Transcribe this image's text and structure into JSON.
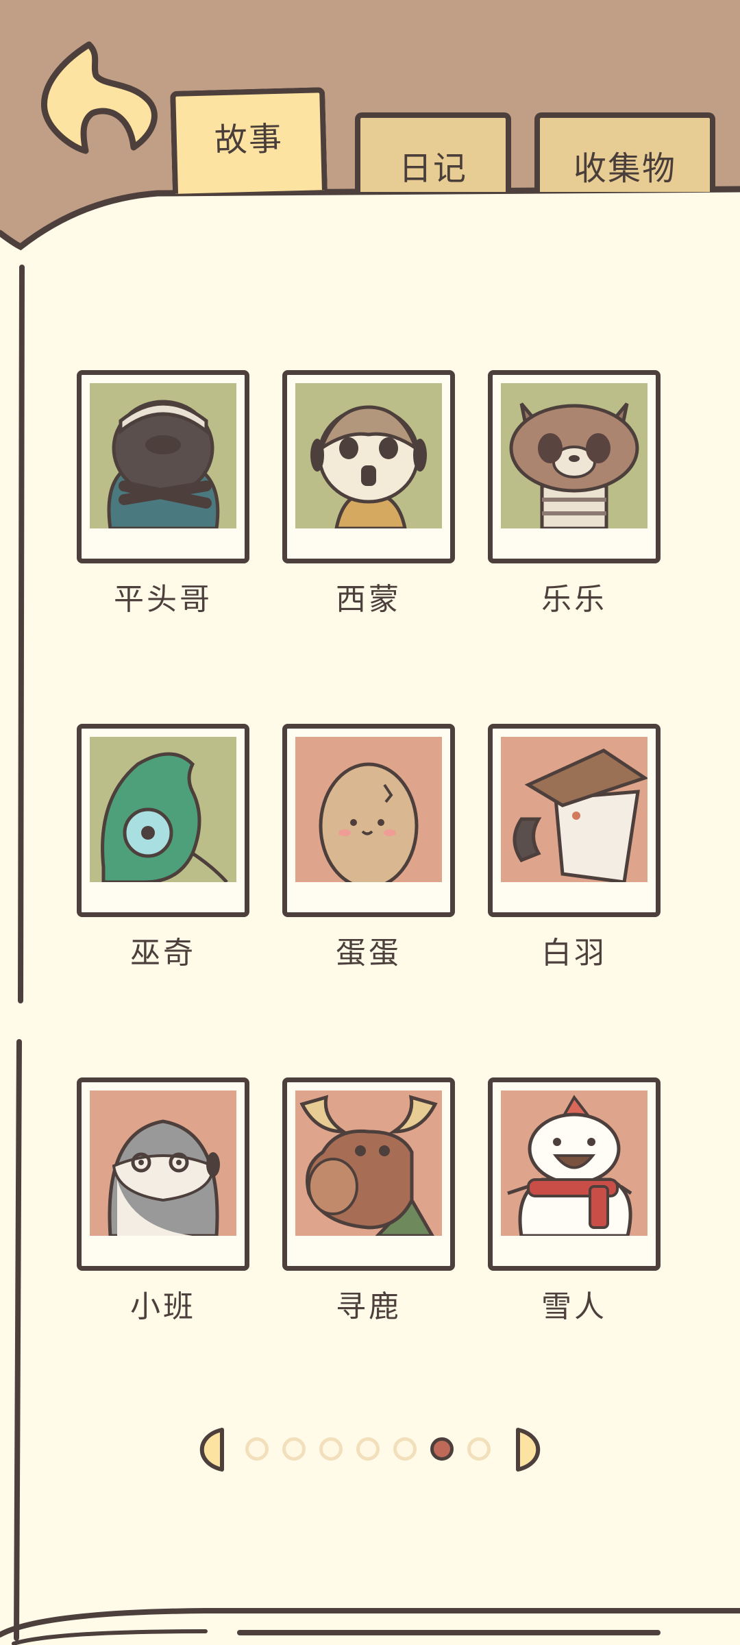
{
  "tabs": {
    "story": "故事",
    "diary": "日记",
    "collection": "收集物"
  },
  "characters": [
    {
      "name": "平头哥",
      "bg": "#bcbe8a",
      "icon": "honey-badger-portrait"
    },
    {
      "name": "西蒙",
      "bg": "#bcbe8a",
      "icon": "meerkat-portrait"
    },
    {
      "name": "乐乐",
      "bg": "#bcbe8a",
      "icon": "raccoon-dog-portrait"
    },
    {
      "name": "巫奇",
      "bg": "#bcbe8a",
      "icon": "chameleon-portrait"
    },
    {
      "name": "蛋蛋",
      "bg": "#dfa58c",
      "icon": "egg-portrait"
    },
    {
      "name": "白羽",
      "bg": "#dfa58c",
      "icon": "bird-portrait"
    },
    {
      "name": "小班",
      "bg": "#dfa58c",
      "icon": "otter-portrait"
    },
    {
      "name": "寻鹿",
      "bg": "#dfa58c",
      "icon": "moose-portrait"
    },
    {
      "name": "雪人",
      "bg": "#dfa58c",
      "icon": "snowman-portrait"
    }
  ],
  "pagination": {
    "total_pages": 7,
    "current_page": 6
  },
  "colors": {
    "outline": "#4d3f3c",
    "paper": "#fffbe8",
    "background": "#c09f86",
    "tab_active": "#fde3a1",
    "tab_inactive": "#e7cc93",
    "dot_active": "#bf6a58"
  }
}
